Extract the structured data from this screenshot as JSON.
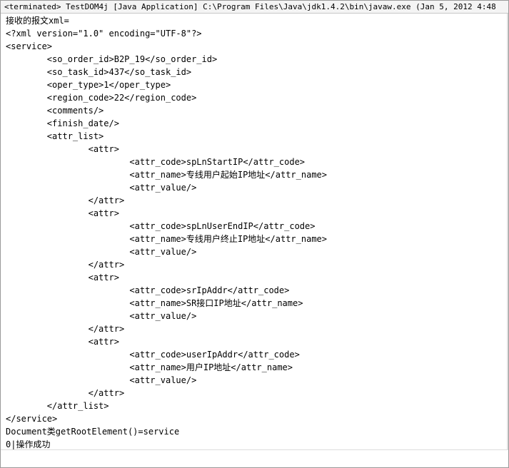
{
  "console": {
    "title": "<terminated> TestDOM4j [Java Application] C:\\Program Files\\Java\\jdk1.4.2\\bin\\javaw.exe (Jan 5, 2012 4:48",
    "lines": [
      "接收的报文xml=",
      "<?xml version=\"1.0\" encoding=\"UTF-8\"?>",
      "<service>",
      "        <so_order_id>B2P_19</so_order_id>",
      "        <so_task_id>437</so_task_id>",
      "        <oper_type>1</oper_type>",
      "        <region_code>22</region_code>",
      "        <comments/>",
      "        <finish_date/>",
      "        <attr_list>",
      "                <attr>",
      "                        <attr_code>spLnStartIP</attr_code>",
      "                        <attr_name>专线用户起始IP地址</attr_name>",
      "                        <attr_value/>",
      "                </attr>",
      "                <attr>",
      "                        <attr_code>spLnUserEndIP</attr_code>",
      "                        <attr_name>专线用户终止IP地址</attr_name>",
      "                        <attr_value/>",
      "                </attr>",
      "                <attr>",
      "                        <attr_code>srIpAddr</attr_code>",
      "                        <attr_name>SR接口IP地址</attr_name>",
      "                        <attr_value/>",
      "                </attr>",
      "                <attr>",
      "                        <attr_code>userIpAddr</attr_code>",
      "                        <attr_name>用户IP地址</attr_name>",
      "                        <attr_value/>",
      "                </attr>",
      "        </attr_list>",
      "</service>",
      "Document类getRootElement()=service",
      "0|操作成功"
    ]
  }
}
